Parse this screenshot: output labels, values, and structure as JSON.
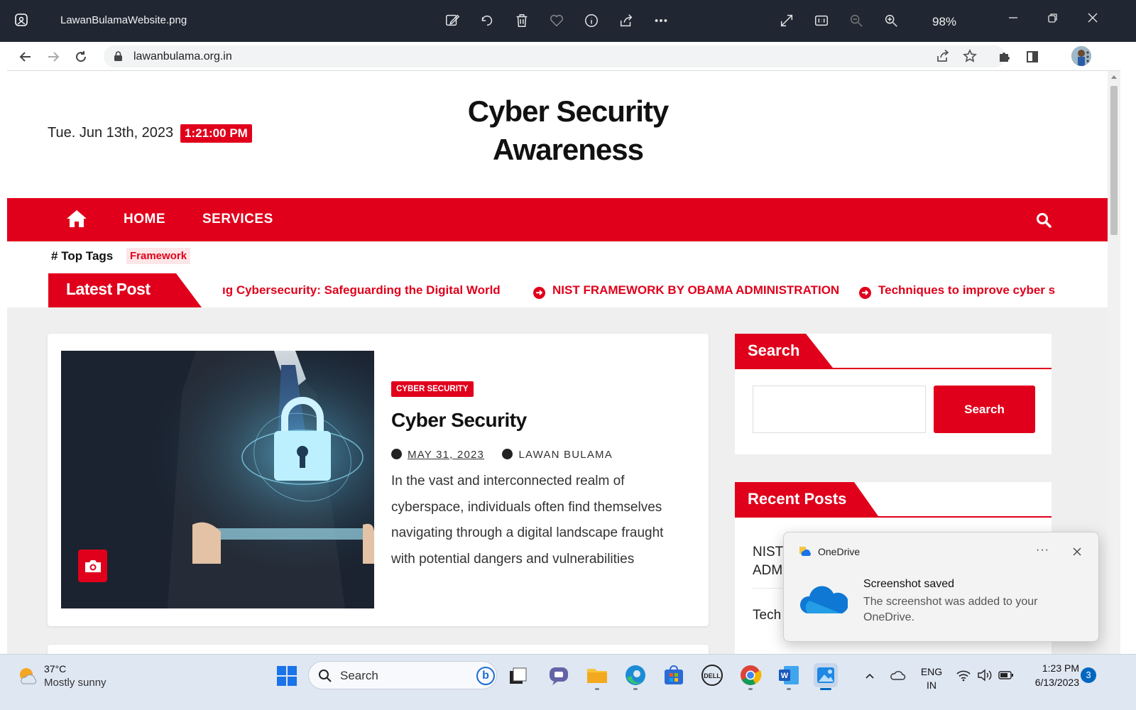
{
  "viewer": {
    "filename": "LawanBulamaWebsite.png",
    "zoom": "98%",
    "toolbar_icons": [
      "edit-icon",
      "rotate-icon",
      "delete-icon",
      "favorite-icon",
      "info-icon",
      "share-icon",
      "more-icon",
      "fullscreen-icon",
      "actual-size-icon",
      "zoom-out-icon",
      "zoom-in-icon"
    ]
  },
  "browser": {
    "url": "lawanbulama.org.in"
  },
  "site": {
    "date": "Tue. Jun 13th, 2023",
    "time": "1:21:00 PM",
    "title_line1": "Cyber Security",
    "title_line2": "Awareness",
    "nav": {
      "home": "HOME",
      "services": "SERVICES"
    },
    "top_tags_label": "Top Tags",
    "tags": [
      "Framework"
    ],
    "latest_label": "Latest Post",
    "ticker": [
      "ıg Cybersecurity: Safeguarding the Digital World",
      "NIST FRAMEWORK BY OBAMA ADMINISTRATION",
      "Techniques to improve cyber s"
    ]
  },
  "post": {
    "category": "CYBER SECURITY",
    "title": "Cyber Security",
    "date": "MAY 31, 2023",
    "author": "LAWAN BULAMA",
    "excerpt": "In the vast and interconnected realm of cyberspace, individuals often find themselves navigating through a digital landscape fraught with potential dangers and vulnerabilities"
  },
  "sidebar": {
    "search_title": "Search",
    "search_button": "Search",
    "search_placeholder": "",
    "recent_title": "Recent Posts",
    "recent_items": [
      "NIST",
      "ADM",
      "Tech"
    ]
  },
  "toast": {
    "app": "OneDrive",
    "title": "Screenshot saved",
    "body": "The screenshot was added to your OneDrive.",
    "more": "···"
  },
  "taskbar": {
    "temp": "37°C",
    "weather": "Mostly sunny",
    "search": "Search",
    "lang": "ENG",
    "region": "IN",
    "time": "1:23 PM",
    "date": "6/13/2023",
    "notifications": "3"
  },
  "colors": {
    "brand_red": "#e0001b",
    "viewer_bar": "#202733",
    "taskbar": "#dfe7f3"
  }
}
